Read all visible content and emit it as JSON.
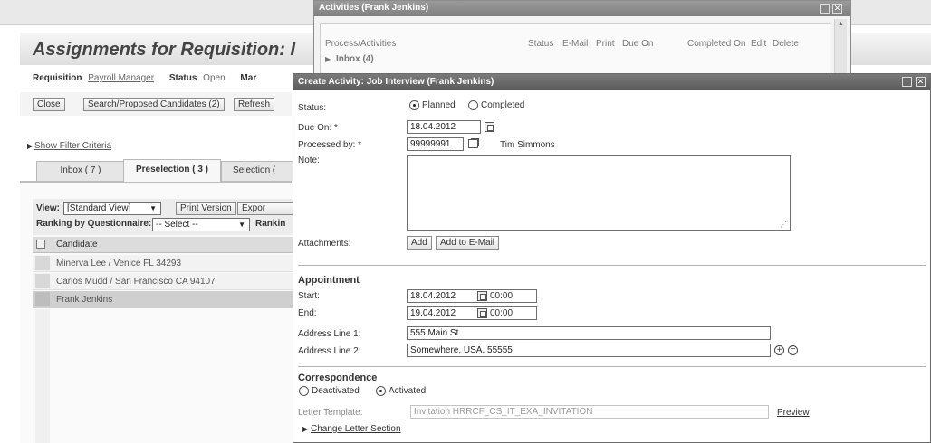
{
  "background": {
    "page_title": "Assignments for Requisition: I",
    "requisition_label": "Requisition",
    "requisition_value": "Payroll Manager",
    "status_label": "Status",
    "status_value": "Open",
    "mar_label": "Mar",
    "buttons": {
      "close": "Close",
      "search": "Search/Proposed Candidates (2)",
      "refresh": "Refresh"
    },
    "show_filter": "Show Filter Criteria",
    "tabs": [
      "Inbox ( 7 )",
      "Preselection ( 3 )",
      "Selection ("
    ],
    "view_label": "View:",
    "view_value": "[Standard View]",
    "print_version": "Print Version",
    "export": "Expor",
    "ranking_q_label": "Ranking by Questionnaire:",
    "ranking_q_value": "-- Select --",
    "ranking_label": "Rankin",
    "table": {
      "header": "Candidate",
      "rows": [
        "Minerva Lee / Venice FL 34293",
        "Carlos Mudd / San Francisco CA 94107",
        "Frank Jenkins"
      ]
    }
  },
  "activities_window": {
    "title": "Activities (Frank Jenkins)",
    "columns": [
      "Process/Activities",
      "Status",
      "E-Mail",
      "Print",
      "Due On",
      "Completed On",
      "Edit",
      "Delete"
    ],
    "inbox": "Inbox (4)"
  },
  "dialog": {
    "title": "Create Activity: Job Interview (Frank Jenkins)",
    "status_label": "Status:",
    "status_options": [
      "Planned",
      "Completed"
    ],
    "due_on_label": "Due On: *",
    "due_on_value": "18.04.2012",
    "processed_by_label": "Processed by: *",
    "processed_by_value": "99999991",
    "processed_by_name": "Tim Simmons",
    "note_label": "Note:",
    "attachments_label": "Attachments:",
    "add_button": "Add",
    "add_email_button": "Add to E-Mail",
    "appointment_header": "Appointment",
    "start_label": "Start:",
    "start_date": "18.04.2012",
    "start_time": "00:00",
    "end_label": "End:",
    "end_date": "19.04.2012",
    "end_time": "00:00",
    "address1_label": "Address Line 1:",
    "address1_value": "555 Main St.",
    "address2_label": "Address Line 2:",
    "address2_value": "Somewhere, USA, 55555",
    "correspondence_header": "Correspondence",
    "corr_options": [
      "Deactivated",
      "Activated"
    ],
    "letter_template_label": "Letter Template:",
    "letter_template_value": "Invitation HRRCF_CS_IT_EXA_INVITATION",
    "preview_link": "Preview",
    "change_letter_link": "Change Letter Section"
  },
  "icons": [
    "calendar-icon",
    "value-help-icon",
    "plus-icon",
    "minus-icon",
    "maximize-icon",
    "close-icon"
  ]
}
